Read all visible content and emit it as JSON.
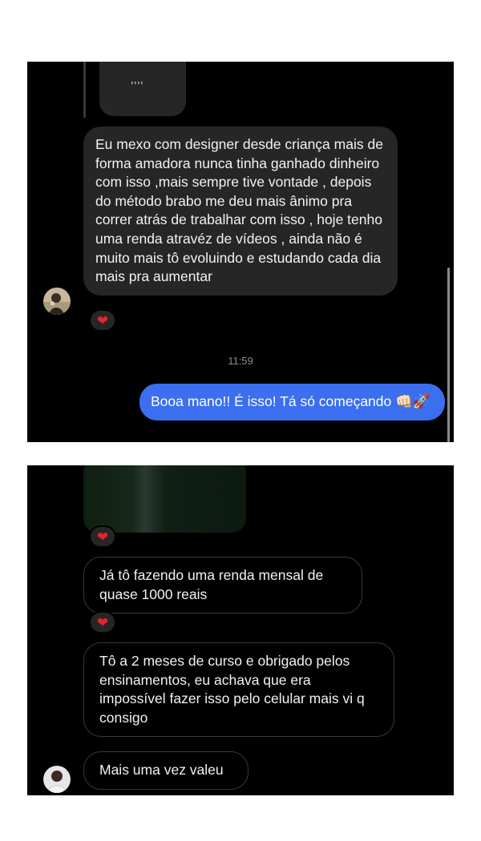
{
  "top_screenshot": {
    "media_caption": "’’’’",
    "incoming_message": "Eu mexo com designer desde criança mais de forma amadora nunca tinha ganhado dinheiro com isso ,mais sempre tive vontade , depois do método brabo me deu mais ânimo pra correr atrás de trabalhar com isso , hoje tenho uma renda atravéz de vídeos , ainda não é muito mais tô evoluindo e estudando cada dia mais pra aumentar",
    "reaction": "❤",
    "timestamp": "11:59",
    "outgoing_message": "Booa mano!! É isso! Tá só começando 👊🏻🚀"
  },
  "bottom_screenshot": {
    "reaction_media": "❤",
    "message_1": "Já tô fazendo uma renda mensal de quase 1000 reais",
    "reaction_1": "❤",
    "message_2": "Tô a 2 meses de curso e obrigado pelos ensinamentos, eu achava que era impossível fazer isso pelo celular mais vi q consigo",
    "message_3": "Mais uma vez valeu"
  },
  "colors": {
    "chat_background": "#000000",
    "incoming_bubble": "#262626",
    "outgoing_bubble": "#3b6fef",
    "heart": "#e8232b",
    "timestamp": "#8e8e93"
  },
  "icons": [
    "avatar-photo",
    "heart-reaction-icon"
  ]
}
